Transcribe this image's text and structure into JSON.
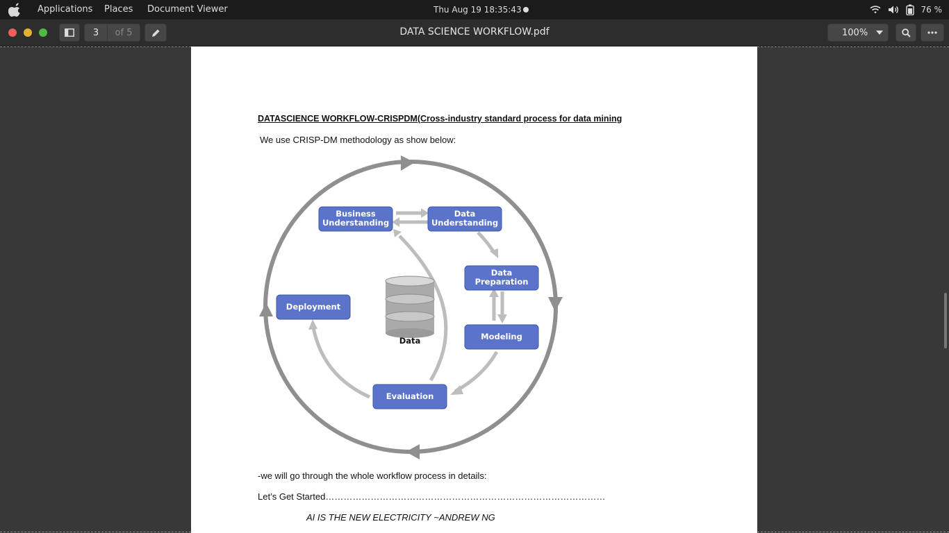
{
  "system_bar": {
    "menus": [
      "Applications",
      "Places",
      "Document Viewer"
    ],
    "clock": "Thu Aug 19  18:35:43",
    "battery": "76 %"
  },
  "toolbar": {
    "current_page": "3",
    "page_total": "of 5",
    "title": "DATA SCIENCE WORKFLOW.pdf",
    "zoom": "100%"
  },
  "document": {
    "heading": "DATASCIENCE WORKFLOW-CRISPDM(Cross-industry standard process for data mining",
    "intro": "We use CRISP-DM methodology as show below:",
    "diagram": {
      "business": [
        "Business",
        "Understanding"
      ],
      "data_understanding": [
        "Data",
        "Understanding"
      ],
      "data_preparation": [
        "Data",
        "Preparation"
      ],
      "modeling": "Modeling",
      "evaluation": "Evaluation",
      "deployment": "Deployment",
      "data": "Data"
    },
    "line1": "-we will go through the whole workflow process in details:",
    "line2": "Let’s Get Started…………………………………………………………………………………",
    "quote": "AI IS THE NEW ELECTRICITY ~ANDREW NG"
  }
}
